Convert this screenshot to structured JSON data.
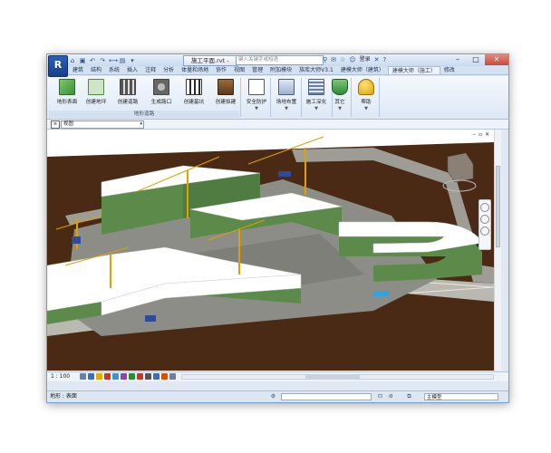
{
  "titlebar": {
    "app_letter": "R",
    "doc_title": "施工平面.rvt -",
    "search_placeholder": "键入关键字或短语",
    "login": "登录",
    "help": "?"
  },
  "tabs": [
    "建筑",
    "结构",
    "系统",
    "插入",
    "注释",
    "分析",
    "体量和场地",
    "协作",
    "视图",
    "管理",
    "附加模块",
    "族库大师V3.1",
    "建模大师（建筑）",
    "建模大师（施工）",
    "修改"
  ],
  "active_tab": "建模大师（施工）",
  "ribbon": {
    "panel_terrain": "地形道路",
    "buttons": [
      {
        "label": "地形表面",
        "icon": "terrain-surface-icon"
      },
      {
        "label": "创建地坪",
        "icon": "create-floor-icon"
      },
      {
        "label": "创建道路",
        "icon": "create-road-icon"
      },
      {
        "label": "生成路口",
        "icon": "create-junction-icon"
      },
      {
        "label": "创建基坑",
        "icon": "create-pit-icon"
      },
      {
        "label": "创建拟建",
        "icon": "create-proposed-icon"
      },
      {
        "label": "安全防护",
        "icon": "safety-protection-icon"
      },
      {
        "label": "场地布置",
        "icon": "site-layout-icon"
      },
      {
        "label": "施工深化",
        "icon": "construction-detail-icon"
      },
      {
        "label": "其它",
        "icon": "other-shield-icon"
      },
      {
        "label": "帮助",
        "icon": "help-key-icon"
      }
    ]
  },
  "properties": {
    "type_selector": "视图"
  },
  "viewbar": {
    "scale": "1 : 100"
  },
  "statusbar": {
    "status_text": "地形 : 表面",
    "model_combo": "主模型",
    "value_combo": ":0"
  },
  "colors": {
    "ground": "#4a2a14",
    "road": "#b9b9b1",
    "building_wall": "#5b8a4a",
    "roof": "#ffffff",
    "crane": "#e0a100"
  }
}
